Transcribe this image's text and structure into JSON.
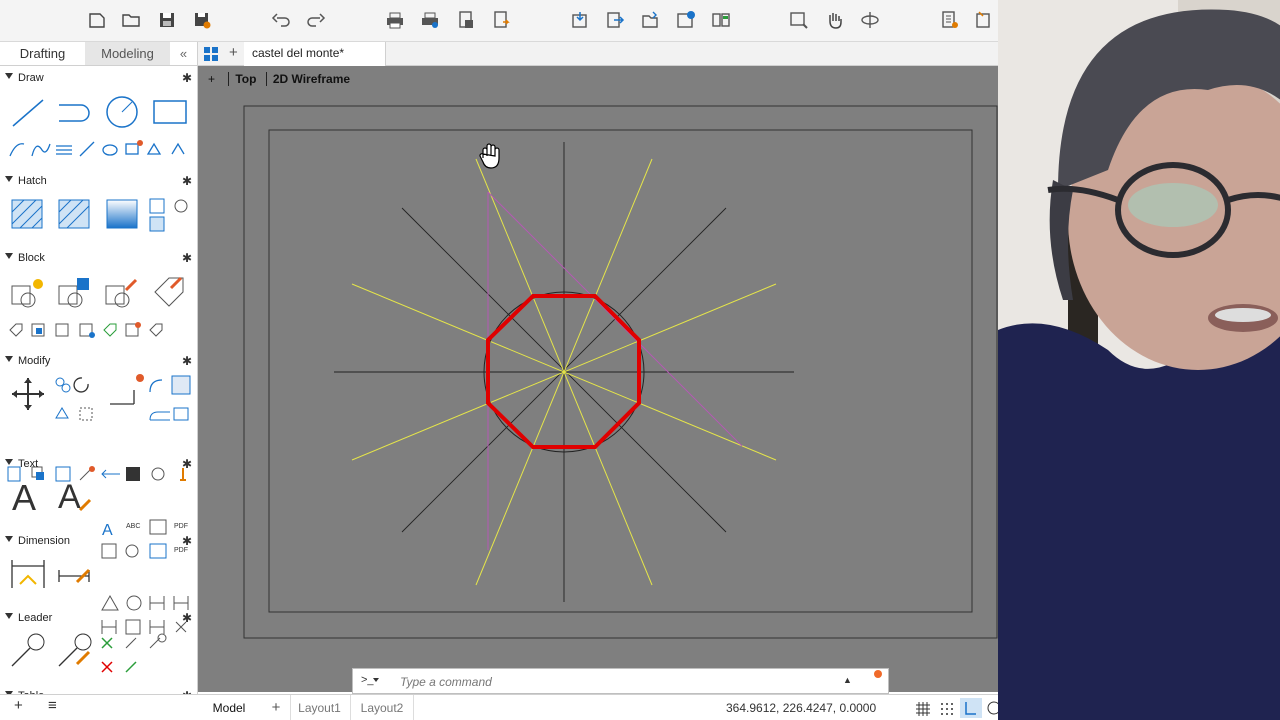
{
  "palette": {
    "tabs": {
      "drafting": "Drafting",
      "modeling": "Modeling",
      "collapse": "«"
    },
    "sections": {
      "draw": "Draw",
      "hatch": "Hatch",
      "block": "Block",
      "modify": "Modify",
      "text": "Text",
      "dimension": "Dimension",
      "leader": "Leader",
      "table": "Table"
    },
    "footer": {
      "add": "+",
      "menu": "≡"
    }
  },
  "file_tab": {
    "name": "castel del monte*",
    "add": "+"
  },
  "viewport": {
    "plus": "+",
    "view": "Top",
    "style": "2D Wireframe"
  },
  "command": {
    "prompt": ">_",
    "placeholder": "Type a command",
    "expand": "▲"
  },
  "status": {
    "tabs": [
      "Model",
      "Layout1",
      "Layout2"
    ],
    "add": "+",
    "coordinates": "364.9612, 226.4247, 0.0000"
  },
  "colors": {
    "accent_red": "#e00000",
    "construction_yellow": "#e5e54a",
    "construction_magenta": "#b45ab4",
    "viewport_bg": "#7f7f7f"
  }
}
